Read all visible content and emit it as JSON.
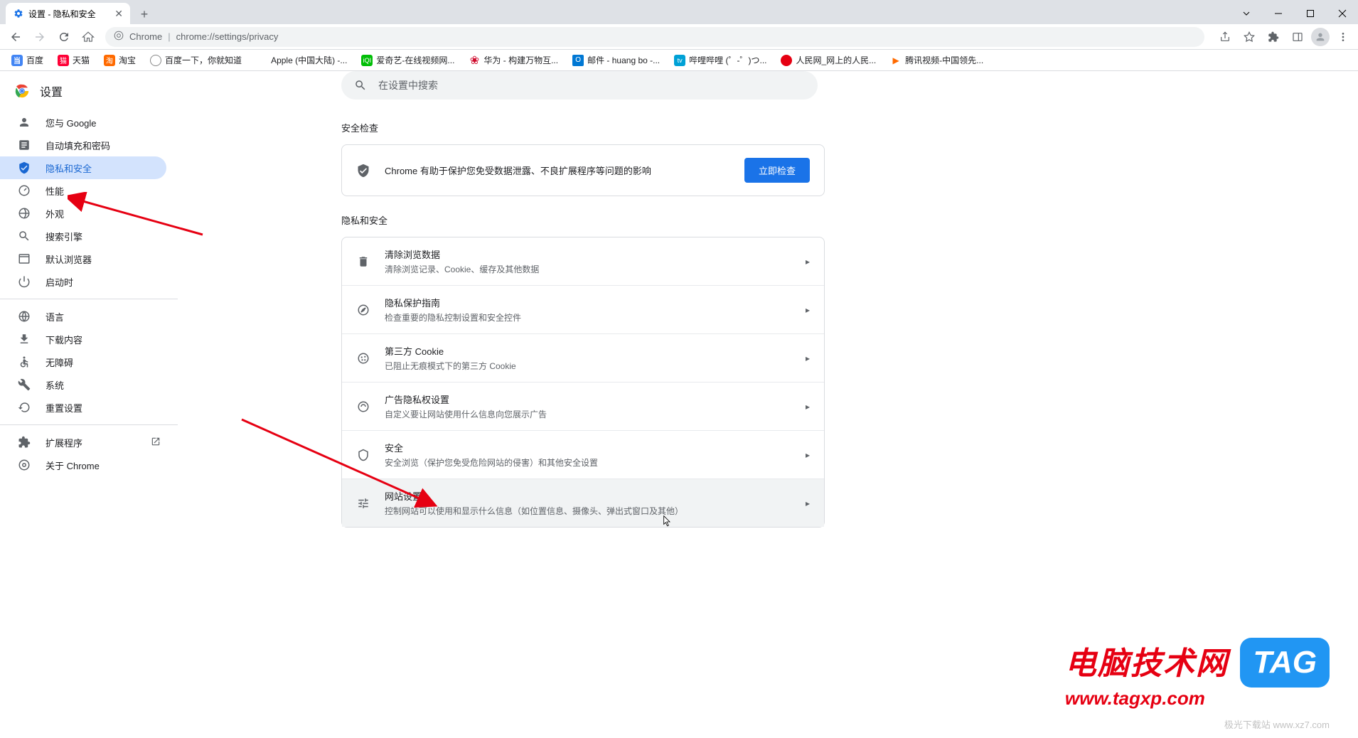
{
  "window": {
    "tab_title": "设置 - 隐私和安全"
  },
  "omnibox": {
    "scheme": "Chrome",
    "url": "chrome://settings/privacy"
  },
  "bookmarks": [
    {
      "label": "百度",
      "color": "#4285f4"
    },
    {
      "label": "天猫",
      "color": "#ff0036"
    },
    {
      "label": "淘宝",
      "color": "#ff6a00"
    },
    {
      "label": "百度一下，你就知道",
      "color": "#888"
    },
    {
      "label": "Apple (中国大陆) -...",
      "color": "#000"
    },
    {
      "label": "爱奇艺-在线视频网...",
      "color": "#00be06"
    },
    {
      "label": "华为 - 构建万物互...",
      "color": "#cf0a2c"
    },
    {
      "label": "邮件 - huang bo -...",
      "color": "#0078d4"
    },
    {
      "label": "哔哩哔哩 (゜-゜)つ...",
      "color": "#00a1d6"
    },
    {
      "label": "人民网_网上的人民...",
      "color": "#e60012"
    },
    {
      "label": "腾讯视频-中国领先...",
      "color": "#ff6a00"
    }
  ],
  "settings": {
    "title": "设置",
    "search_placeholder": "在设置中搜索"
  },
  "sidebar": {
    "items": [
      {
        "label": "您与 Google"
      },
      {
        "label": "自动填充和密码"
      },
      {
        "label": "隐私和安全"
      },
      {
        "label": "性能"
      },
      {
        "label": "外观"
      },
      {
        "label": "搜索引擎"
      },
      {
        "label": "默认浏览器"
      },
      {
        "label": "启动时"
      }
    ],
    "items2": [
      {
        "label": "语言"
      },
      {
        "label": "下载内容"
      },
      {
        "label": "无障碍"
      },
      {
        "label": "系统"
      },
      {
        "label": "重置设置"
      }
    ],
    "items3": [
      {
        "label": "扩展程序"
      },
      {
        "label": "关于 Chrome"
      }
    ]
  },
  "content": {
    "safety_check_title": "安全检查",
    "safety_text": "Chrome 有助于保护您免受数据泄露、不良扩展程序等问题的影响",
    "safety_button": "立即检查",
    "privacy_title": "隐私和安全",
    "rows": [
      {
        "title": "清除浏览数据",
        "sub": "清除浏览记录、Cookie、缓存及其他数据"
      },
      {
        "title": "隐私保护指南",
        "sub": "检查重要的隐私控制设置和安全控件"
      },
      {
        "title": "第三方 Cookie",
        "sub": "已阻止无痕模式下的第三方 Cookie"
      },
      {
        "title": "广告隐私权设置",
        "sub": "自定义要让网站使用什么信息向您展示广告"
      },
      {
        "title": "安全",
        "sub": "安全浏览（保护您免受危险网站的侵害）和其他安全设置"
      },
      {
        "title": "网站设置",
        "sub": "控制网站可以使用和显示什么信息（如位置信息、摄像头、弹出式窗口及其他）"
      }
    ]
  },
  "watermark": {
    "text1": "电脑技术网",
    "text2": "www.tagxp.com",
    "tag": "TAG",
    "small": "极光下载站 www.xz7.com"
  }
}
